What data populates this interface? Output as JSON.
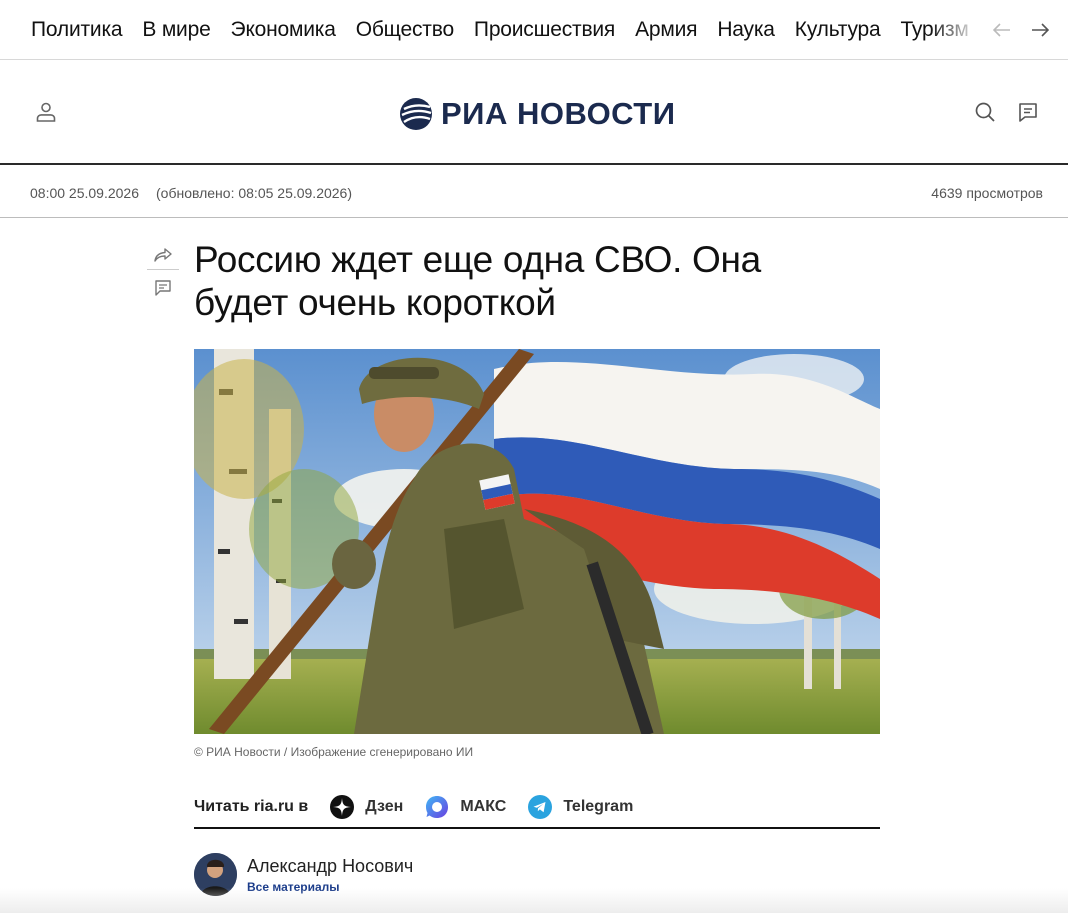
{
  "nav": {
    "items": [
      "Политика",
      "В мире",
      "Экономика",
      "Общество",
      "Происшествия",
      "Армия",
      "Наука",
      "Культура",
      "Туризм"
    ]
  },
  "header": {
    "logo_text": "РИА НОВОСТИ"
  },
  "meta": {
    "published": "08:00 25.09.2026",
    "updated": "(обновлено: 08:05 25.09.2026)",
    "views": "4639 просмотров"
  },
  "article": {
    "title": "Россию ждет еще одна СВО. Она будет очень короткой",
    "caption": "© РИА Новости / Изображение сгенерировано ИИ"
  },
  "readin": {
    "label": "Читать ria.ru в",
    "channels": [
      {
        "name": "Дзен",
        "icon": "dzen-icon"
      },
      {
        "name": "МАКС",
        "icon": "max-icon"
      },
      {
        "name": "Telegram",
        "icon": "telegram-icon"
      }
    ]
  },
  "author": {
    "name": "Александр Носович",
    "all_link": "Все материалы"
  },
  "colors": {
    "brand": "#1b2a4e",
    "link": "#1b3c8a",
    "telegram": "#2aa3df",
    "max": "#3a6fe8"
  }
}
